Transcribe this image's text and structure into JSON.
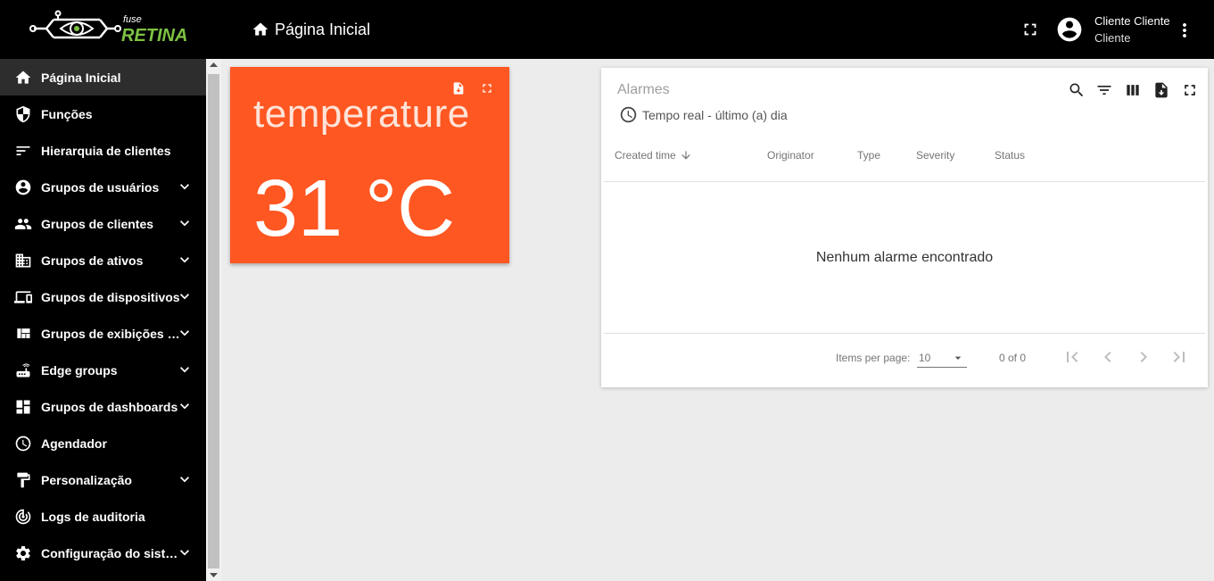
{
  "header": {
    "logo_small": "fuse",
    "logo_big": "RETINA",
    "page_title": "Página Inicial",
    "user_name": "Cliente Cliente",
    "user_role": "Cliente",
    "brand_green": "#7dc242"
  },
  "sidebar": {
    "items": [
      {
        "label": "Página Inicial",
        "icon": "home-icon",
        "expandable": false,
        "active": true
      },
      {
        "label": "Funções",
        "icon": "shield-icon",
        "expandable": false
      },
      {
        "label": "Hierarquia de clientes",
        "icon": "sort-icon",
        "expandable": false
      },
      {
        "label": "Grupos de usuários",
        "icon": "account-circle-icon",
        "expandable": true
      },
      {
        "label": "Grupos de clientes",
        "icon": "people-icon",
        "expandable": true
      },
      {
        "label": "Grupos de ativos",
        "icon": "domain-icon",
        "expandable": true
      },
      {
        "label": "Grupos de dispositivos",
        "icon": "devices-icon",
        "expandable": true
      },
      {
        "label": "Grupos de exibições de entidades",
        "icon": "view-quilt-icon",
        "expandable": true
      },
      {
        "label": "Edge groups",
        "icon": "router-icon",
        "expandable": true
      },
      {
        "label": "Grupos de dashboards",
        "icon": "dashboard-icon",
        "expandable": true
      },
      {
        "label": "Agendador",
        "icon": "schedule-icon",
        "expandable": false
      },
      {
        "label": "Personalização",
        "icon": "format-paint-icon",
        "expandable": true
      },
      {
        "label": "Logs de auditoria",
        "icon": "track-changes-icon",
        "expandable": false
      },
      {
        "label": "Configuração do sistema",
        "icon": "settings-icon",
        "expandable": true
      }
    ]
  },
  "temperature_card": {
    "title": "temperature",
    "value": "31 °C",
    "color": "#ff5722"
  },
  "alarms": {
    "title": "Alarmes",
    "timewindow": "Tempo real - último (a) dia",
    "columns": [
      "Created time",
      "Originator",
      "Type",
      "Severity",
      "Status"
    ],
    "empty_message": "Nenhum alarme encontrado",
    "items_per_page_label": "Items per page:",
    "items_per_page": "10",
    "range": "0 of 0"
  }
}
